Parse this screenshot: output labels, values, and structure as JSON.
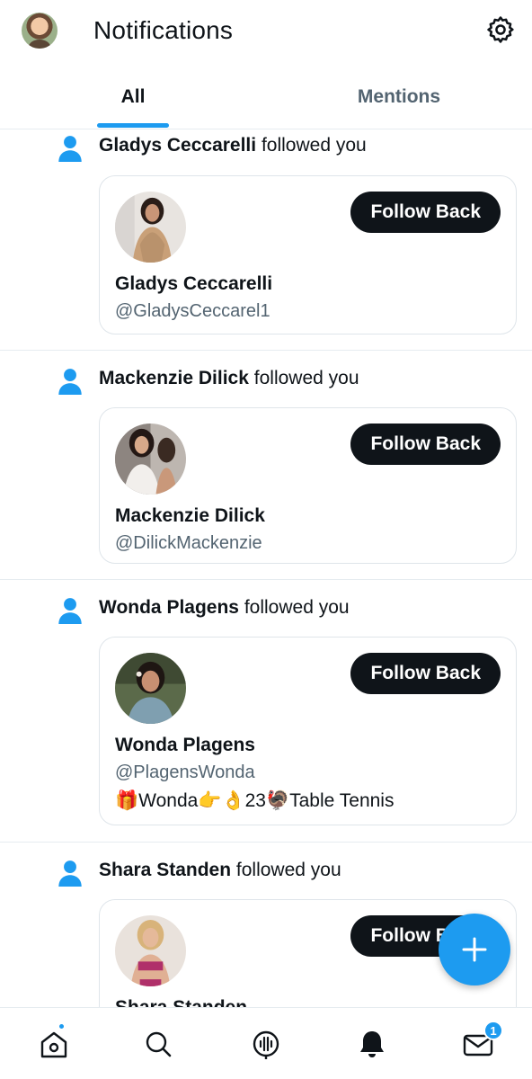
{
  "header": {
    "title": "Notifications"
  },
  "tabs": [
    {
      "label": "All"
    },
    {
      "label": "Mentions"
    }
  ],
  "notifications": [
    {
      "name": "Gladys Ceccarelli",
      "action": "followed you",
      "handle": "@GladysCeccarel1",
      "button": "Follow Back",
      "bio": ""
    },
    {
      "name": "Mackenzie Dilick",
      "action": "followed you",
      "handle": "@DilickMackenzie",
      "button": "Follow Back",
      "bio": ""
    },
    {
      "name": "Wonda Plagens",
      "action": "followed you",
      "handle": "@PlagensWonda",
      "button": "Follow Back",
      "bio": "🎁Wonda👉👌23🦃Table Tennis"
    },
    {
      "name": "Shara Standen",
      "action": "followed you",
      "handle": "",
      "button": "Follow Back",
      "bio": ""
    }
  ],
  "bottom_nav": {
    "items": [
      {
        "icon": "home-icon"
      },
      {
        "icon": "search-icon"
      },
      {
        "icon": "spaces-icon"
      },
      {
        "icon": "bell-icon"
      },
      {
        "icon": "mail-icon"
      }
    ],
    "messages_badge": "1"
  },
  "colors": {
    "accent": "#1d9bf0",
    "button_dark": "#0f1419",
    "secondary_text": "#536471"
  }
}
